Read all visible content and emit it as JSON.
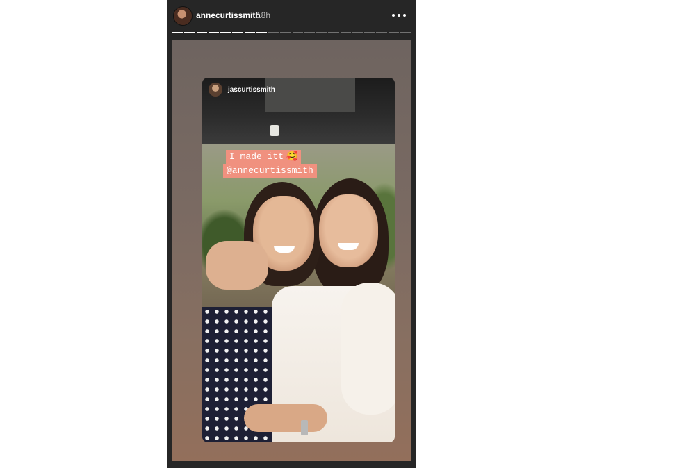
{
  "story": {
    "username": "annecurtissmith",
    "timestamp": "18h",
    "more_icon": "more-horizontal-icon",
    "progress": {
      "segments": 20,
      "completed": 8
    }
  },
  "reshared_post": {
    "username": "jascurtissmith",
    "caption_line1": "I made itt",
    "caption_emoji": "🥰",
    "caption_line2": "@annecurtissmith"
  },
  "colors": {
    "frame_bg": "#262626",
    "caption_bg": "#f0917f"
  }
}
